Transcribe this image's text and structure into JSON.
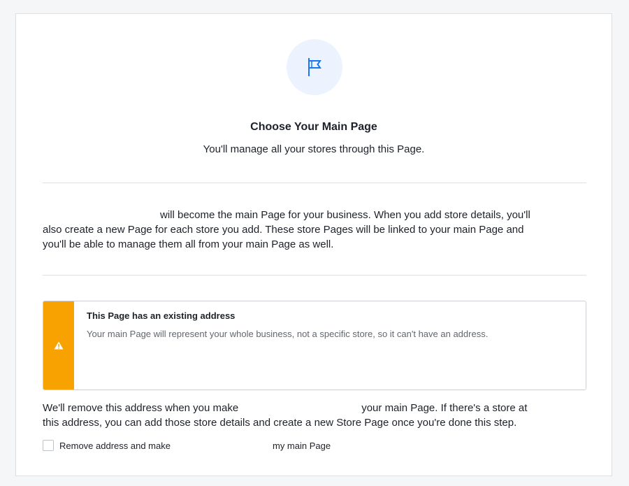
{
  "dialog": {
    "icon": "flag-icon",
    "title": "Choose Your Main Page",
    "subtitle": "You'll manage all your stores through this Page.",
    "intro": {
      "line1": "will become the main Page for your business. When you add store details, you'll",
      "line2": "also create a new Page for each store you add. These store Pages will be linked to your main Page and",
      "line3": "you'll be able to manage them all from your main Page as well."
    },
    "warning": {
      "icon": "warning-triangle-icon",
      "title": "This Page has an existing address",
      "text": "Your main Page will represent your whole business, not a specific store, so it can't have an address."
    },
    "notice": {
      "prefix": "We'll remove this address when you make",
      "suffix": "your main Page. If there's a store at",
      "line2": "this address, you can add those store details and create a new Store Page once you're done this step."
    },
    "checkbox": {
      "label_prefix": "Remove address and make",
      "label_suffix": "my main Page",
      "checked": false
    }
  },
  "colors": {
    "accent": "#1877f2",
    "warning": "#f7a200",
    "icon_bg": "#ecf3ff"
  }
}
